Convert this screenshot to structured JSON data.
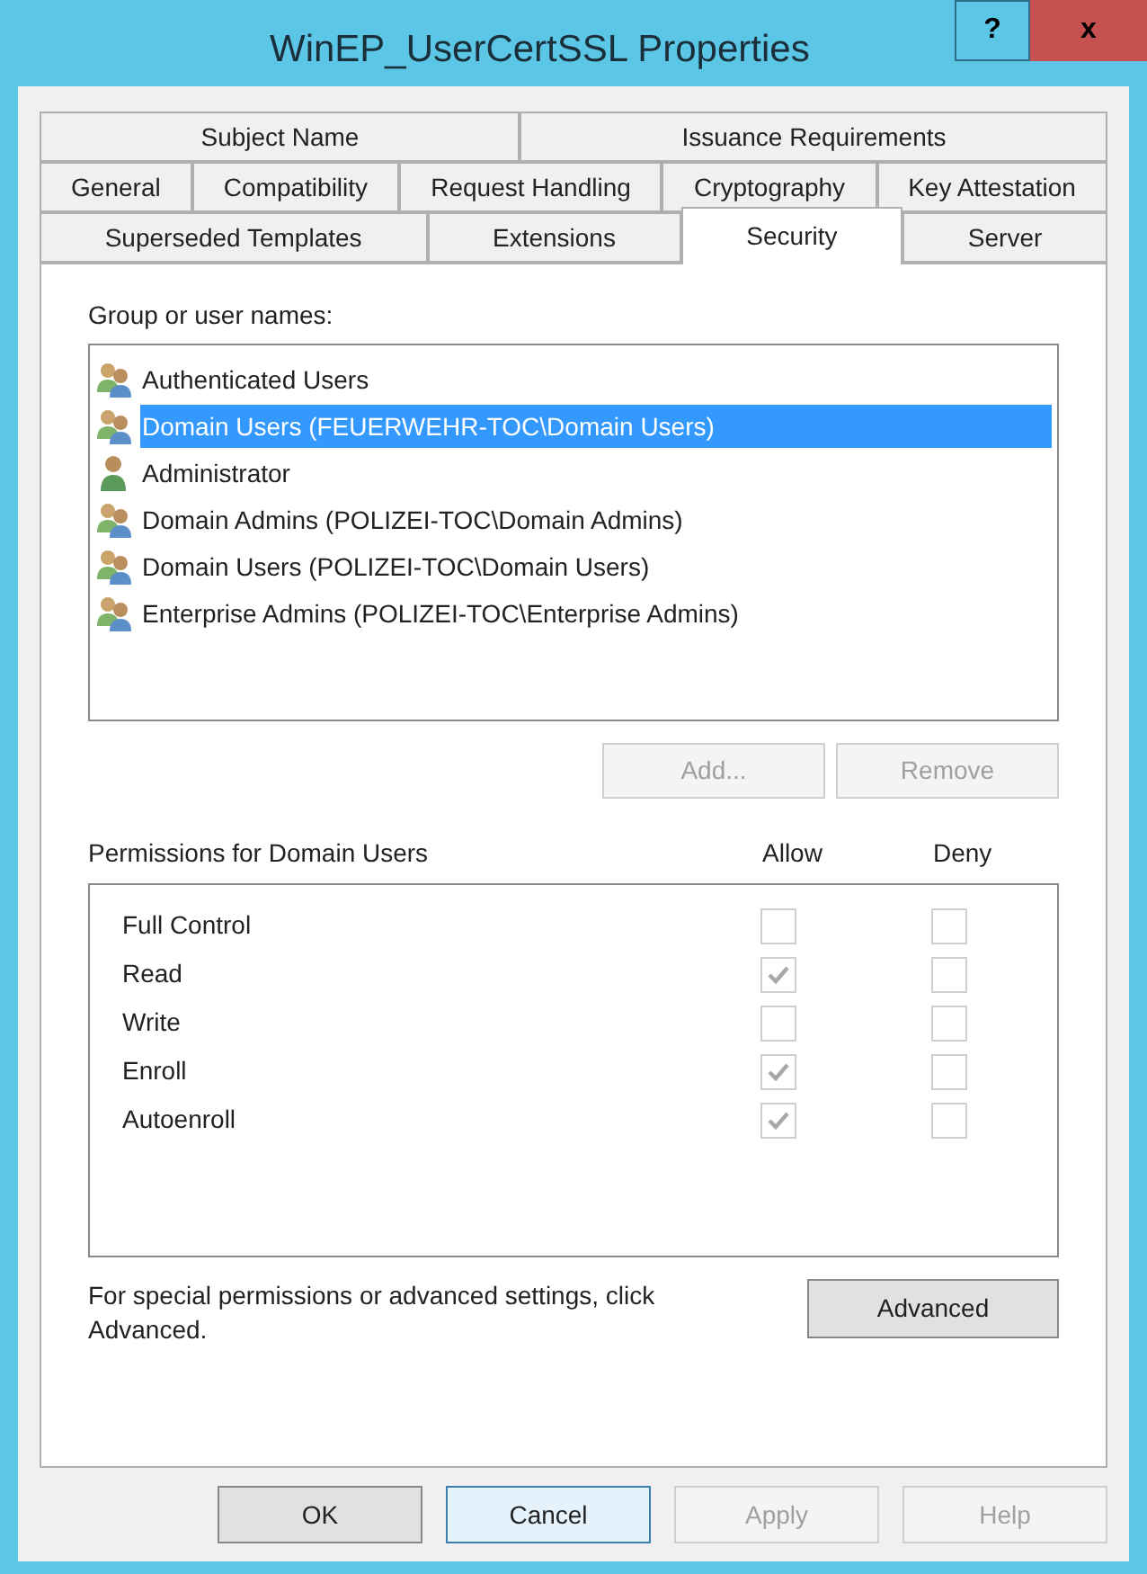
{
  "window": {
    "title": "WinEP_UserCertSSL Properties",
    "help_button": "?",
    "close_button": "x"
  },
  "tab_rows": [
    [
      {
        "label": "Subject Name",
        "selected": false
      },
      {
        "label": "Issuance Requirements",
        "selected": false
      }
    ],
    [
      {
        "label": "General",
        "selected": false
      },
      {
        "label": "Compatibility",
        "selected": false
      },
      {
        "label": "Request Handling",
        "selected": false
      },
      {
        "label": "Cryptography",
        "selected": false
      },
      {
        "label": "Key Attestation",
        "selected": false
      }
    ],
    [
      {
        "label": "Superseded Templates",
        "selected": false
      },
      {
        "label": "Extensions",
        "selected": false
      },
      {
        "label": "Security",
        "selected": true
      },
      {
        "label": "Server",
        "selected": false
      }
    ]
  ],
  "group_label": "Group or user names:",
  "principals": [
    {
      "kind": "group",
      "name": "Authenticated Users",
      "selected": false
    },
    {
      "kind": "group",
      "name": "Domain Users (FEUERWEHR-TOC\\Domain Users)",
      "selected": true
    },
    {
      "kind": "user",
      "name": "Administrator",
      "selected": false
    },
    {
      "kind": "group",
      "name": "Domain Admins (POLIZEI-TOC\\Domain Admins)",
      "selected": false
    },
    {
      "kind": "group",
      "name": "Domain Users (POLIZEI-TOC\\Domain Users)",
      "selected": false
    },
    {
      "kind": "group",
      "name": "Enterprise Admins (POLIZEI-TOC\\Enterprise Admins)",
      "selected": false
    }
  ],
  "list_buttons": [
    {
      "label": "Add...",
      "disabled": true
    },
    {
      "label": "Remove",
      "disabled": true
    }
  ],
  "permissions": {
    "title": "Permissions for Domain Users",
    "allow_header": "Allow",
    "deny_header": "Deny",
    "rows": [
      {
        "name": "Full Control",
        "allow": {
          "checked": false,
          "disabled": true
        },
        "deny": {
          "checked": false,
          "disabled": true
        }
      },
      {
        "name": "Read",
        "allow": {
          "checked": true,
          "disabled": true
        },
        "deny": {
          "checked": false,
          "disabled": true
        }
      },
      {
        "name": "Write",
        "allow": {
          "checked": false,
          "disabled": true
        },
        "deny": {
          "checked": false,
          "disabled": true
        }
      },
      {
        "name": "Enroll",
        "allow": {
          "checked": true,
          "disabled": true
        },
        "deny": {
          "checked": false,
          "disabled": true
        }
      },
      {
        "name": "Autoenroll",
        "allow": {
          "checked": true,
          "disabled": true
        },
        "deny": {
          "checked": false,
          "disabled": true
        }
      }
    ]
  },
  "advanced_text": "For special permissions or advanced settings, click Advanced.",
  "advanced_button": "Advanced",
  "dialog_buttons": [
    {
      "label": "OK",
      "disabled": false,
      "focused": false
    },
    {
      "label": "Cancel",
      "disabled": false,
      "focused": true
    },
    {
      "label": "Apply",
      "disabled": true,
      "focused": false
    },
    {
      "label": "Help",
      "disabled": true,
      "focused": false
    }
  ]
}
